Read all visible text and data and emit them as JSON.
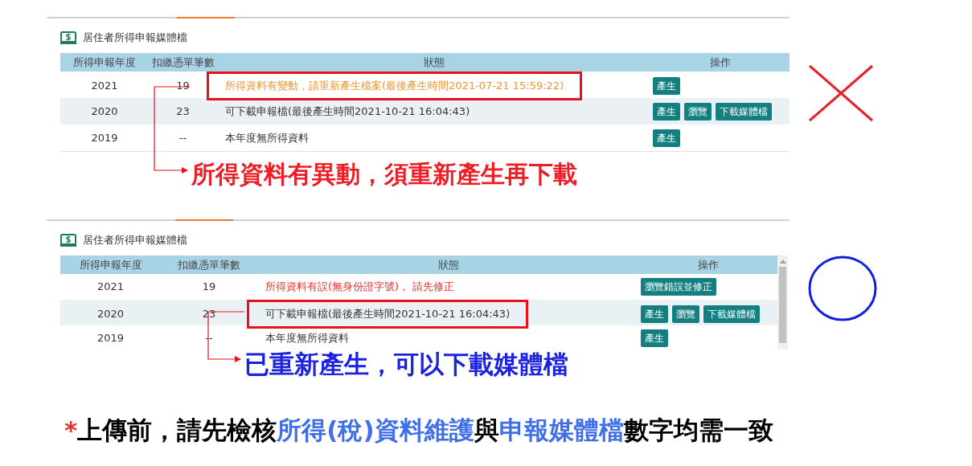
{
  "panels": [
    {
      "kind": "wrong",
      "title": "居住者所得申報媒體檔",
      "columns": [
        "所得申報年度",
        "扣繳憑單筆數",
        "狀態",
        "操作"
      ],
      "rows": [
        {
          "year": "2021",
          "count": "19",
          "status": "所得資料有變動，請重新產生檔案(最後產生時間2021-07-21 15:59:22)",
          "kind": "warning",
          "highlighted": true,
          "actions": [
            "產生"
          ]
        },
        {
          "year": "2020",
          "count": "23",
          "status": "可下載申報檔(最後產生時間2021-10-21 16:04:43)",
          "kind": "normal",
          "highlighted": false,
          "actions": [
            "產生",
            "瀏覽",
            "下載媒體檔"
          ]
        },
        {
          "year": "2019",
          "count": "--",
          "status": "本年度無所得資料",
          "kind": "normal",
          "highlighted": false,
          "actions": [
            "產生"
          ]
        }
      ],
      "annotation": "所得資料有異動，須重新產生再下載"
    },
    {
      "kind": "right",
      "title": "居住者所得申報媒體檔",
      "columns": [
        "所得申報年度",
        "扣繳憑單筆數",
        "狀態",
        "操作"
      ],
      "rows": [
        {
          "year": "2021",
          "count": "19",
          "status": "所得資料有誤(無身份證字號)， 請先修正",
          "kind": "error",
          "highlighted": false,
          "actions": [
            "瀏覽錯誤並修正"
          ]
        },
        {
          "year": "2020",
          "count": "23",
          "status": "可下載申報檔(最後產生時間2021-10-21 16:04:43)",
          "kind": "normal",
          "highlighted": true,
          "actions": [
            "產生",
            "瀏覽",
            "下載媒體檔"
          ]
        },
        {
          "year": "2019",
          "count": "--",
          "status": "本年度無所得資料",
          "kind": "normal",
          "highlighted": false,
          "actions": [
            "產生"
          ]
        }
      ],
      "annotation": "已重新產生，可以下載媒體檔"
    }
  ],
  "note": [
    {
      "text": "*",
      "kind": "asterisk"
    },
    {
      "text": "上傳前，請先檢核",
      "kind": "plain"
    },
    {
      "text": "所得(稅)資料維護",
      "kind": "highlight"
    },
    {
      "text": "與",
      "kind": "plain"
    },
    {
      "text": "申報媒體檔",
      "kind": "highlight"
    },
    {
      "text": "數字均需一致",
      "kind": "plain"
    }
  ]
}
